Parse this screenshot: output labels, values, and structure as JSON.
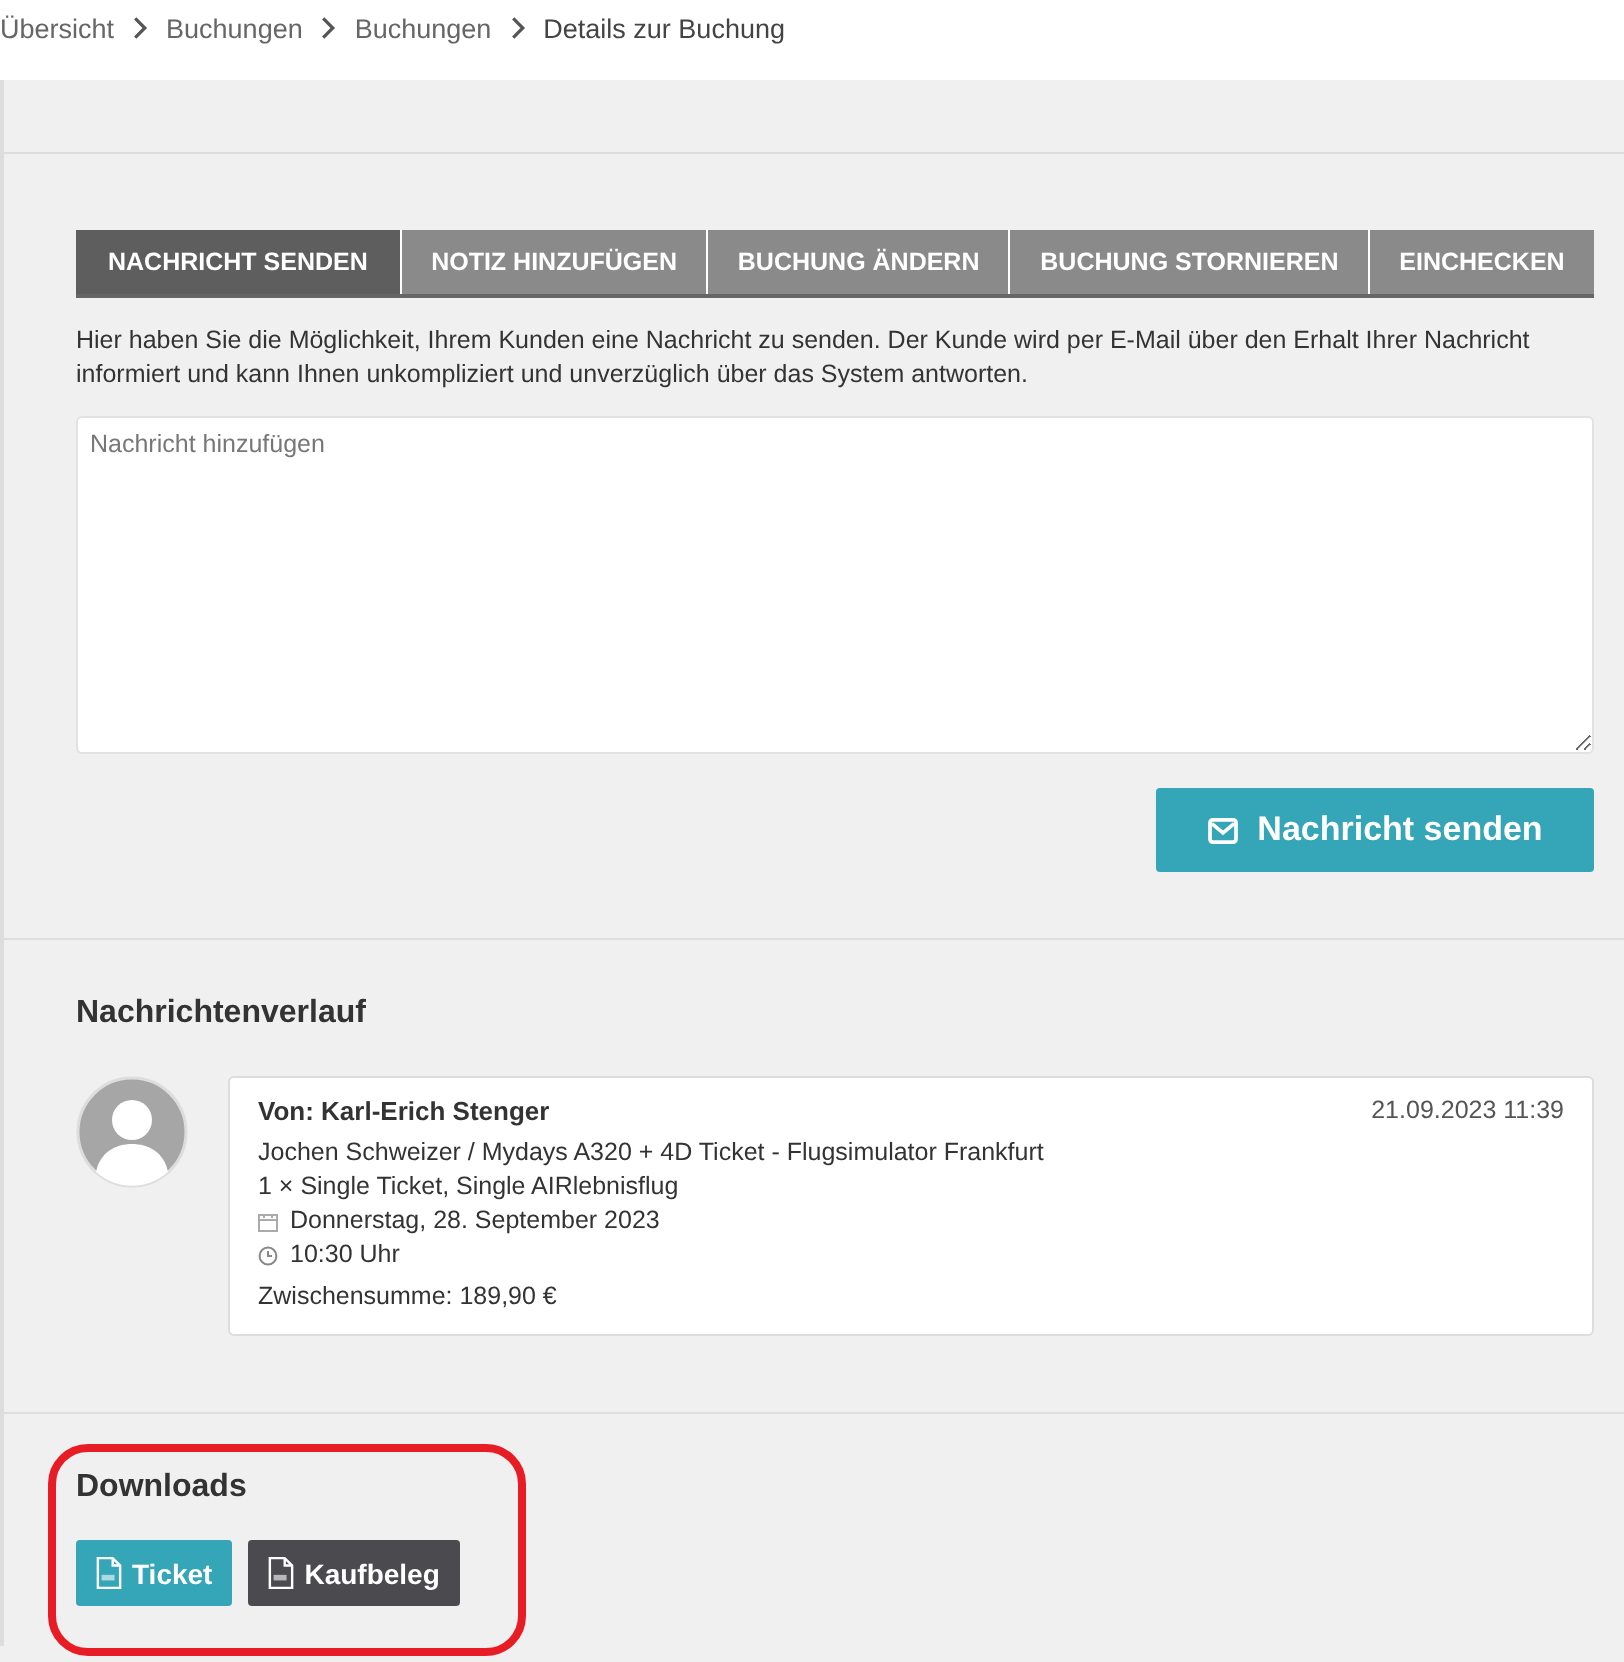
{
  "breadcrumb": [
    {
      "label": "Übersicht",
      "current": false
    },
    {
      "label": "Buchungen",
      "current": false
    },
    {
      "label": "Buchungen",
      "current": false
    },
    {
      "label": "Details zur Buchung",
      "current": true
    }
  ],
  "tabs": [
    {
      "label": "NACHRICHT SENDEN",
      "selected": true
    },
    {
      "label": "NOTIZ HINZUFÜGEN",
      "selected": false
    },
    {
      "label": "BUCHUNG ÄNDERN",
      "selected": false
    },
    {
      "label": "BUCHUNG STORNIEREN",
      "selected": false
    },
    {
      "label": "EINCHECKEN",
      "selected": false
    }
  ],
  "description": "Hier haben Sie die Möglichkeit, Ihrem Kunden eine Nachricht zu senden. Der Kunde wird per E-Mail über den Erhalt Ihrer Nachricht informiert und kann Ihnen unkompliziert und unverzüglich über das System antworten.",
  "message_field": {
    "placeholder": "Nachricht hinzufügen"
  },
  "send_button": "Nachricht senden",
  "history": {
    "title": "Nachrichtenverlauf",
    "messages": [
      {
        "sender": "Von: Karl-Erich Stenger",
        "timestamp": "21.09.2023 11:39",
        "lines": [
          {
            "kind": "text",
            "text": "Jochen Schweizer / Mydays A320 + 4D Ticket - Flugsimulator Frankfurt"
          },
          {
            "kind": "text",
            "text": "1 × Single Ticket, Single AIRlebnisflug"
          },
          {
            "kind": "date",
            "text": "Donnerstag, 28. September 2023"
          },
          {
            "kind": "time",
            "text": "10:30 Uhr"
          },
          {
            "kind": "total",
            "text": "Zwischensumme: 189,90 €"
          }
        ]
      }
    ]
  },
  "downloads": {
    "title": "Downloads",
    "highlighted": true,
    "buttons": [
      {
        "label": "Ticket",
        "kind": "primary"
      },
      {
        "label": "Kaufbeleg",
        "kind": "dark"
      }
    ]
  }
}
